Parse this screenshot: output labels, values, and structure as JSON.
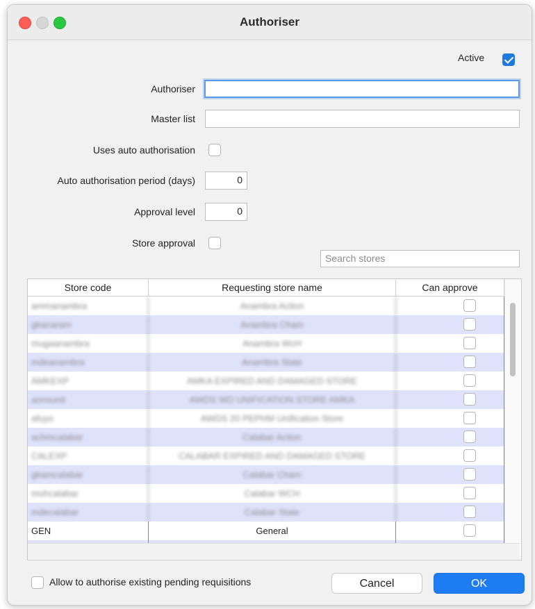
{
  "window": {
    "title": "Authoriser"
  },
  "form": {
    "active_label": "Active",
    "active_checked": true,
    "authoriser_label": "Authoriser",
    "authoriser_value": "",
    "master_list_label": "Master list",
    "master_list_value": "",
    "auto_auth_label": "Uses auto authorisation",
    "auto_auth_checked": false,
    "auto_period_label": "Auto authorisation period (days)",
    "auto_period_value": "0",
    "approval_level_label": "Approval level",
    "approval_level_value": "0",
    "store_approval_label": "Store approval",
    "store_approval_checked": false,
    "search_placeholder": "Search stores"
  },
  "table": {
    "columns": [
      "Store code",
      "Requesting store name",
      "Can approve"
    ],
    "rows": [
      {
        "code": "ammanambra",
        "name": "Anambra Action",
        "can_approve": false
      },
      {
        "code": "gkanaram",
        "name": "Anambra Cham",
        "can_approve": false
      },
      {
        "code": "mugaanambra",
        "name": "Anambra WcH",
        "can_approve": false
      },
      {
        "code": "mdeanambra",
        "name": "Anambra State",
        "can_approve": false
      },
      {
        "code": "AMKEXP",
        "name": "AMKA EXPIRED AND DAMAGED STORE",
        "can_approve": false
      },
      {
        "code": "aonsunit",
        "name": "AWDS WD UNIFICATION STORE AMKA",
        "can_approve": false
      },
      {
        "code": "afuyo",
        "name": "AWDS 20 PEPHM Unification Store",
        "can_approve": false
      },
      {
        "code": "achmcalabar",
        "name": "Calabar Action",
        "can_approve": false
      },
      {
        "code": "CALEXP",
        "name": "CALABAR EXPIRED AND DAMAGED STORE",
        "can_approve": false
      },
      {
        "code": "gkamcalabar",
        "name": "Calabar Cham",
        "can_approve": false
      },
      {
        "code": "mohcalabar",
        "name": "Calabar WCH",
        "can_approve": false
      },
      {
        "code": "mdecalabar",
        "name": "Calabar State",
        "can_approve": false
      },
      {
        "code": "GEN",
        "name": "General",
        "can_approve": false
      }
    ]
  },
  "footer": {
    "allow_pending_label": "Allow to authorise existing pending requisitions",
    "allow_pending_checked": false,
    "cancel_label": "Cancel",
    "ok_label": "OK"
  },
  "colors": {
    "accent": "#1d7cf2",
    "row_alt": "#dfe2fb"
  }
}
